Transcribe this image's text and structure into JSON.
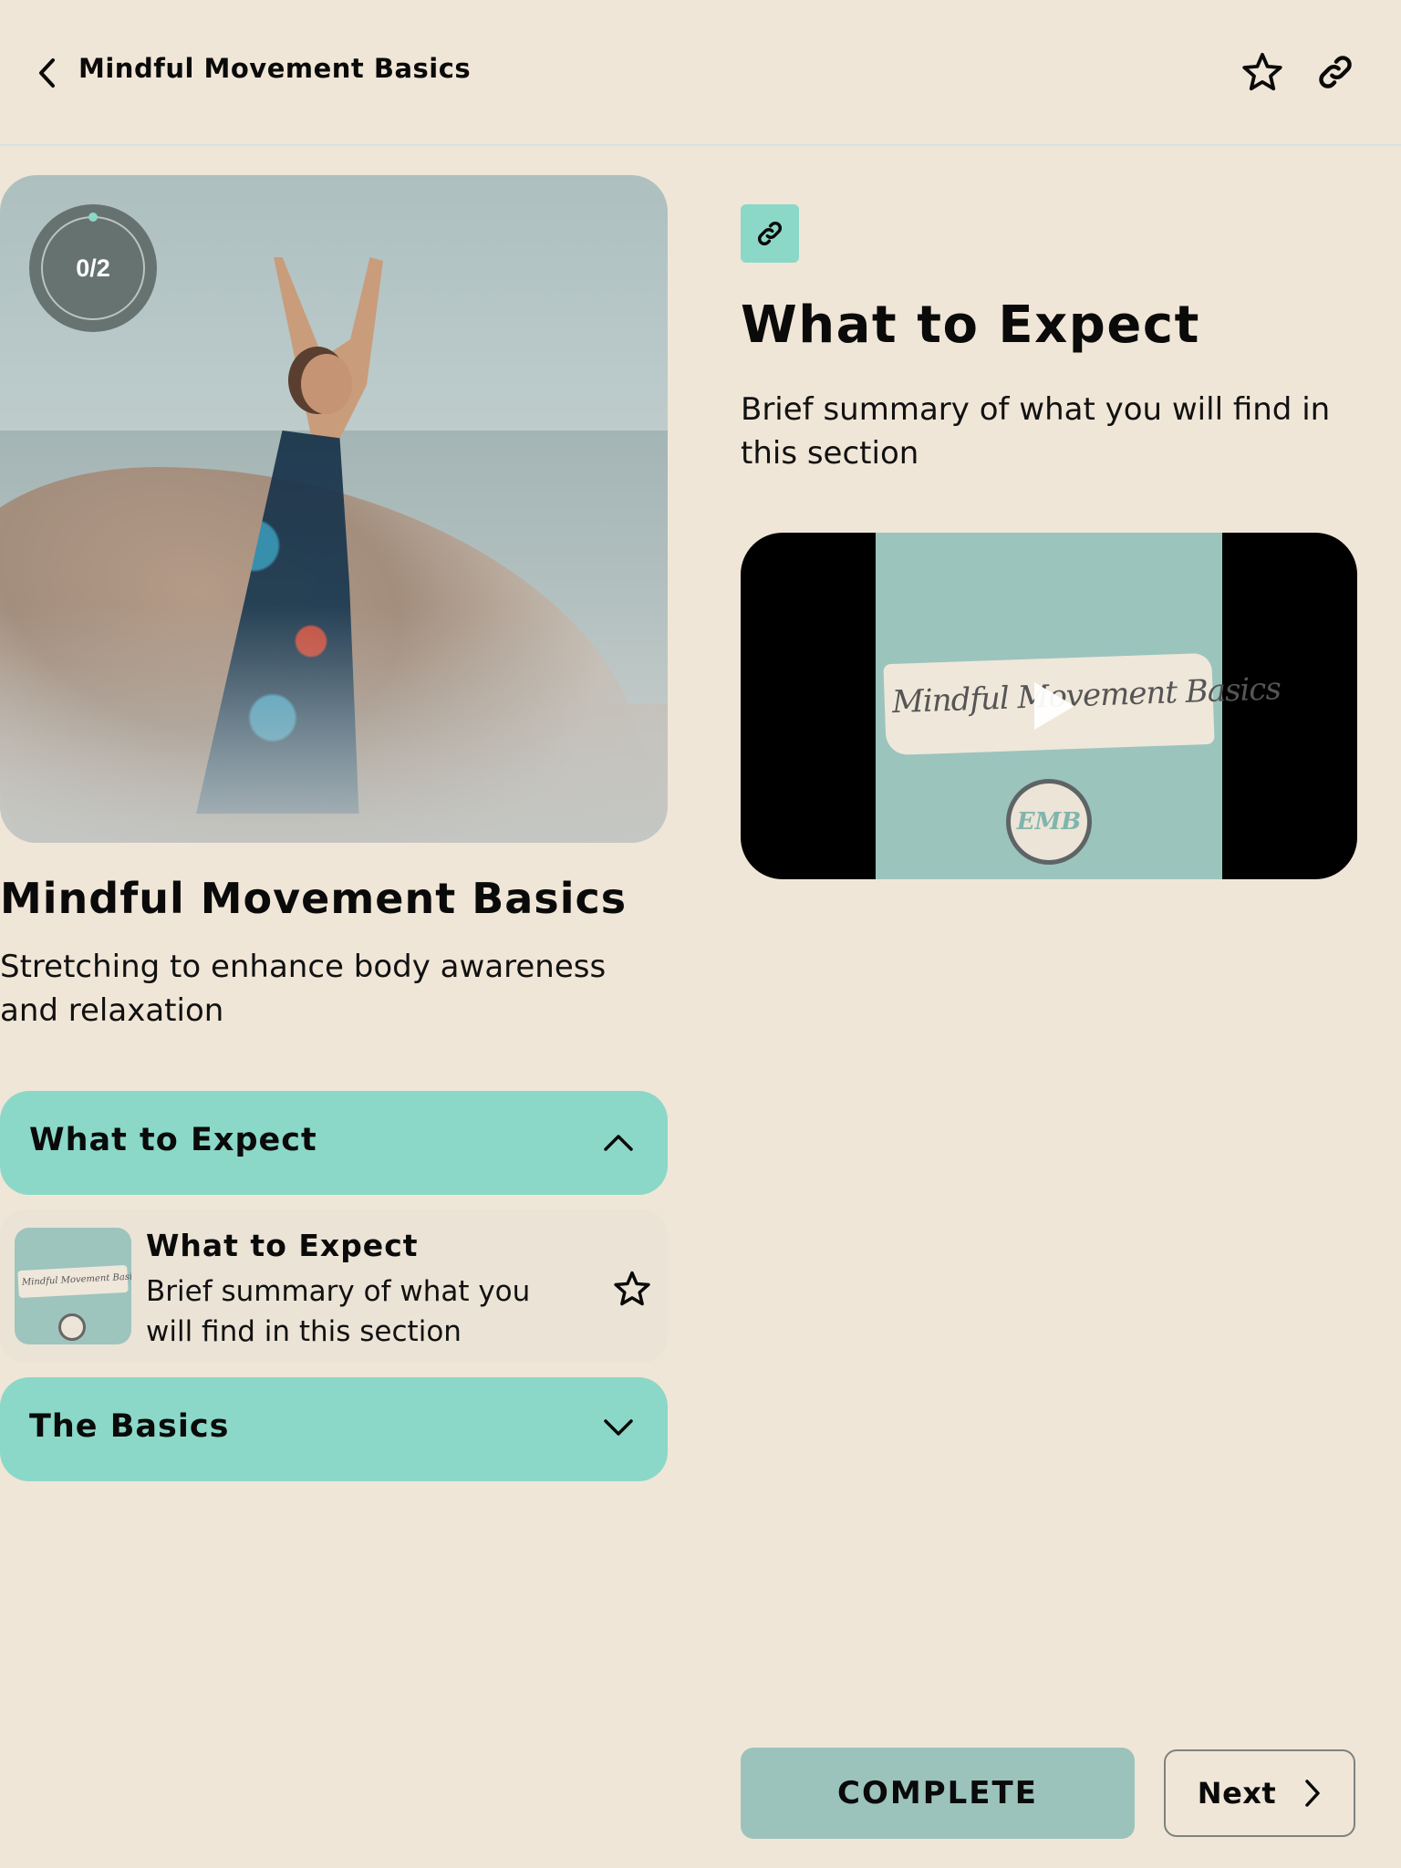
{
  "header": {
    "title": "Mindful Movement Basics",
    "back_icon": "chevron-left-icon",
    "favorite_icon": "star-outline-icon",
    "share_icon": "link-icon"
  },
  "course": {
    "title": "Mindful Movement Basics",
    "description": "Stretching to enhance body awareness and relaxation",
    "progress_label": "0/2",
    "progress_completed": 0,
    "progress_total": 2
  },
  "sections": [
    {
      "label": "What to Expect",
      "expanded": true,
      "chevron_icon": "chevron-up-icon",
      "lessons": [
        {
          "title": "What to Expect",
          "description": "Brief summary of what you will find in this section",
          "thumbnail_text": "Mindful Movement Basics",
          "favorite_icon": "star-outline-icon"
        }
      ]
    },
    {
      "label": "The Basics",
      "expanded": false,
      "chevron_icon": "chevron-down-icon"
    }
  ],
  "detail": {
    "type_icon": "link-icon",
    "title": "What to Expect",
    "description": "Brief summary of what you will find in this section",
    "video": {
      "poster_script_text": "Mindful Movement Basics",
      "emblem_text": "EMB",
      "play_icon": "play-icon"
    }
  },
  "footer": {
    "complete_label": "COMPLETE",
    "next_label": "Next",
    "next_icon": "chevron-right-icon"
  },
  "colors": {
    "background": "#f0e6d7",
    "accent": "#8bd8c8",
    "complete_button": "#9bc3bb",
    "lesson_card": "#ebe3d6",
    "progress_ring_bg": "#5f6b69",
    "progress_dot": "#8bd8c8"
  }
}
